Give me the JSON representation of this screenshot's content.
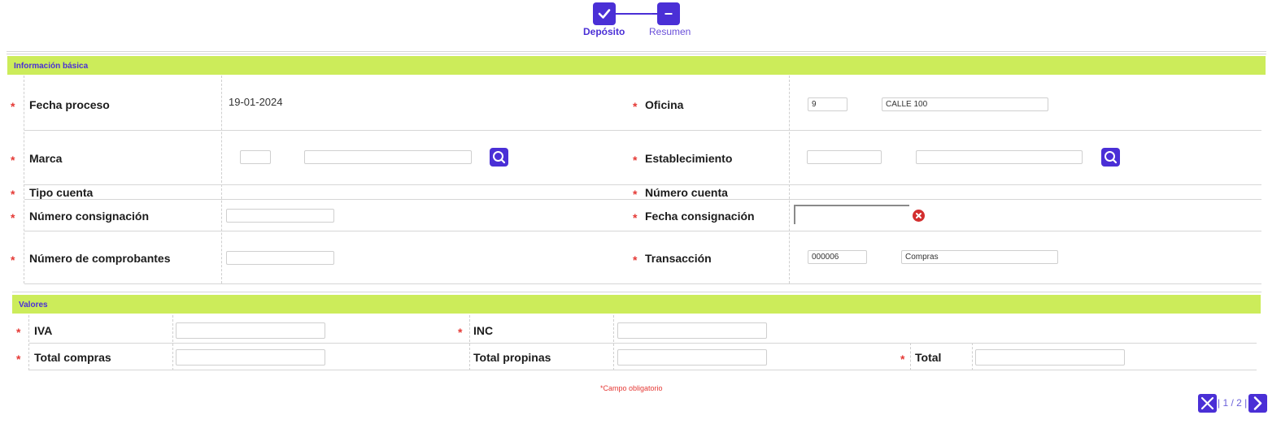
{
  "stepper": {
    "steps": [
      {
        "label": "Depósito",
        "state": "done"
      },
      {
        "label": "Resumen",
        "state": "current"
      }
    ]
  },
  "basic": {
    "title": "Información básica",
    "fecha_proceso": {
      "label": "Fecha proceso",
      "value": "19-01-2024"
    },
    "oficina": {
      "label": "Oficina",
      "code": "9",
      "name": "CALLE 100"
    },
    "marca": {
      "label": "Marca",
      "code": "",
      "name": ""
    },
    "establecimiento": {
      "label": "Establecimiento",
      "code": "",
      "name": ""
    },
    "tipo_cuenta": {
      "label": "Tipo cuenta"
    },
    "numero_cuenta": {
      "label": "Número cuenta"
    },
    "numero_consignacion": {
      "label": "Número consignación",
      "value": ""
    },
    "fecha_consignacion": {
      "label": "Fecha consignación",
      "value": ""
    },
    "numero_comprobantes": {
      "label": "Número de comprobantes",
      "value": ""
    },
    "transaccion": {
      "label": "Transacción",
      "code": "000006",
      "name": "Compras"
    }
  },
  "valores": {
    "title": "Valores",
    "iva": {
      "label": "IVA",
      "value": ""
    },
    "inc": {
      "label": "INC",
      "value": ""
    },
    "total_compras": {
      "label": "Total compras",
      "value": ""
    },
    "total_propinas": {
      "label": "Total propinas",
      "value": ""
    },
    "total": {
      "label": "Total",
      "value": ""
    }
  },
  "required_marker": "*",
  "footnote": {
    "marker": "*",
    "text": "Campo obligatorio"
  },
  "pager": {
    "text": "| 1 / 2 |"
  },
  "icons": {
    "step_done": "check-icon",
    "step_current": "minus-icon",
    "search": "search-icon",
    "clear": "close-circle-icon",
    "close": "close-icon",
    "next": "chevron-right-icon"
  },
  "colors": {
    "accent": "#4a2fd6",
    "band": "#ccec5a",
    "required": "#e53935"
  }
}
